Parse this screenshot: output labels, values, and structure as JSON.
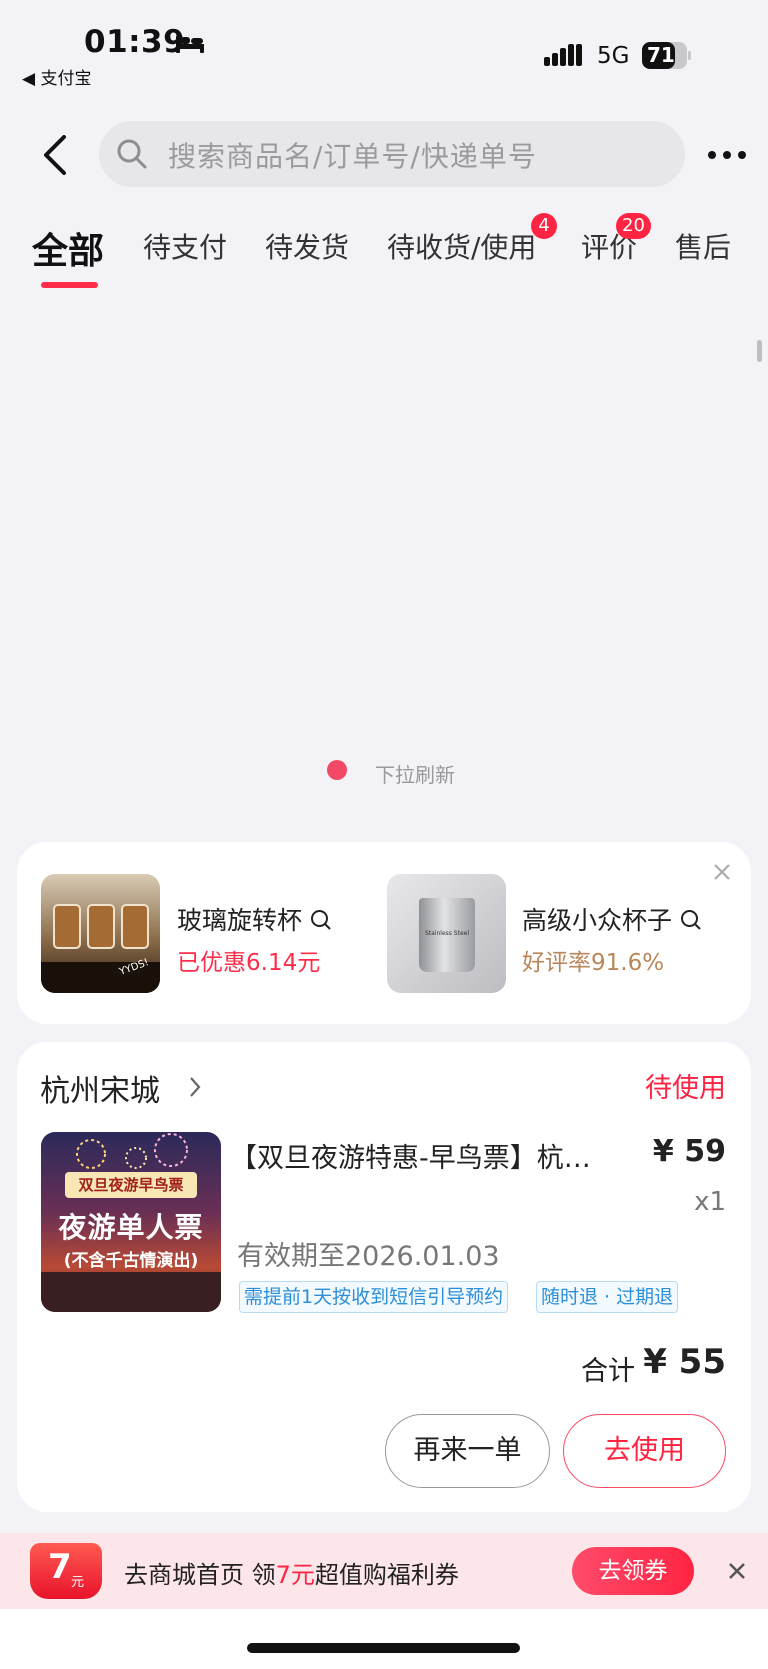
{
  "status_bar": {
    "time": "01:39",
    "back_app": "◀ 支付宝",
    "network": "5G",
    "battery": "71"
  },
  "header": {
    "search_placeholder": "搜索商品名/订单号/快递单号"
  },
  "tabs": [
    {
      "label": "全部",
      "active": true
    },
    {
      "label": "待支付"
    },
    {
      "label": "待发货"
    },
    {
      "label": "待收货/使用",
      "badge": "4"
    },
    {
      "label": "评价",
      "badge": "20"
    },
    {
      "label": "售后"
    }
  ],
  "refresh": {
    "text": "下拉刷新"
  },
  "recommendations": [
    {
      "title": "玻璃旋转杯",
      "subtitle": "已优惠6.14元",
      "subtitle_color": "#ff2d4a",
      "image_text": "YYDS!"
    },
    {
      "title": "高级小众杯子",
      "subtitle": "好评率91.6%",
      "subtitle_color": "#b9875a",
      "image_text": "Stainless Steel"
    }
  ],
  "order": {
    "shop": "杭州宋城",
    "status": "待使用",
    "product_title": "【双旦夜游特惠-早鸟票】杭…",
    "price": "¥ 59",
    "quantity": "x1",
    "validity": "有效期至2026.01.03",
    "tags": [
      "需提前1天按收到短信引导预约",
      "随时退 · 过期退"
    ],
    "total_label": "合计",
    "total_value": "¥ 55",
    "buttons": {
      "reorder": "再来一单",
      "use": "去使用"
    },
    "image": {
      "banner": "双旦夜游早鸟票",
      "title": "夜游单人票",
      "subtitle": "(不含千古情演出)"
    }
  },
  "promo": {
    "coupon_amount": "7",
    "coupon_unit": "元",
    "text_prefix": "去商城首页 领",
    "text_highlight": "7元",
    "text_suffix": "超值购福利券",
    "button": "去领券"
  },
  "colors": {
    "accent": "#ff2442",
    "link_blue": "#2c8fd8",
    "banner_bg": "#fde6ea"
  }
}
